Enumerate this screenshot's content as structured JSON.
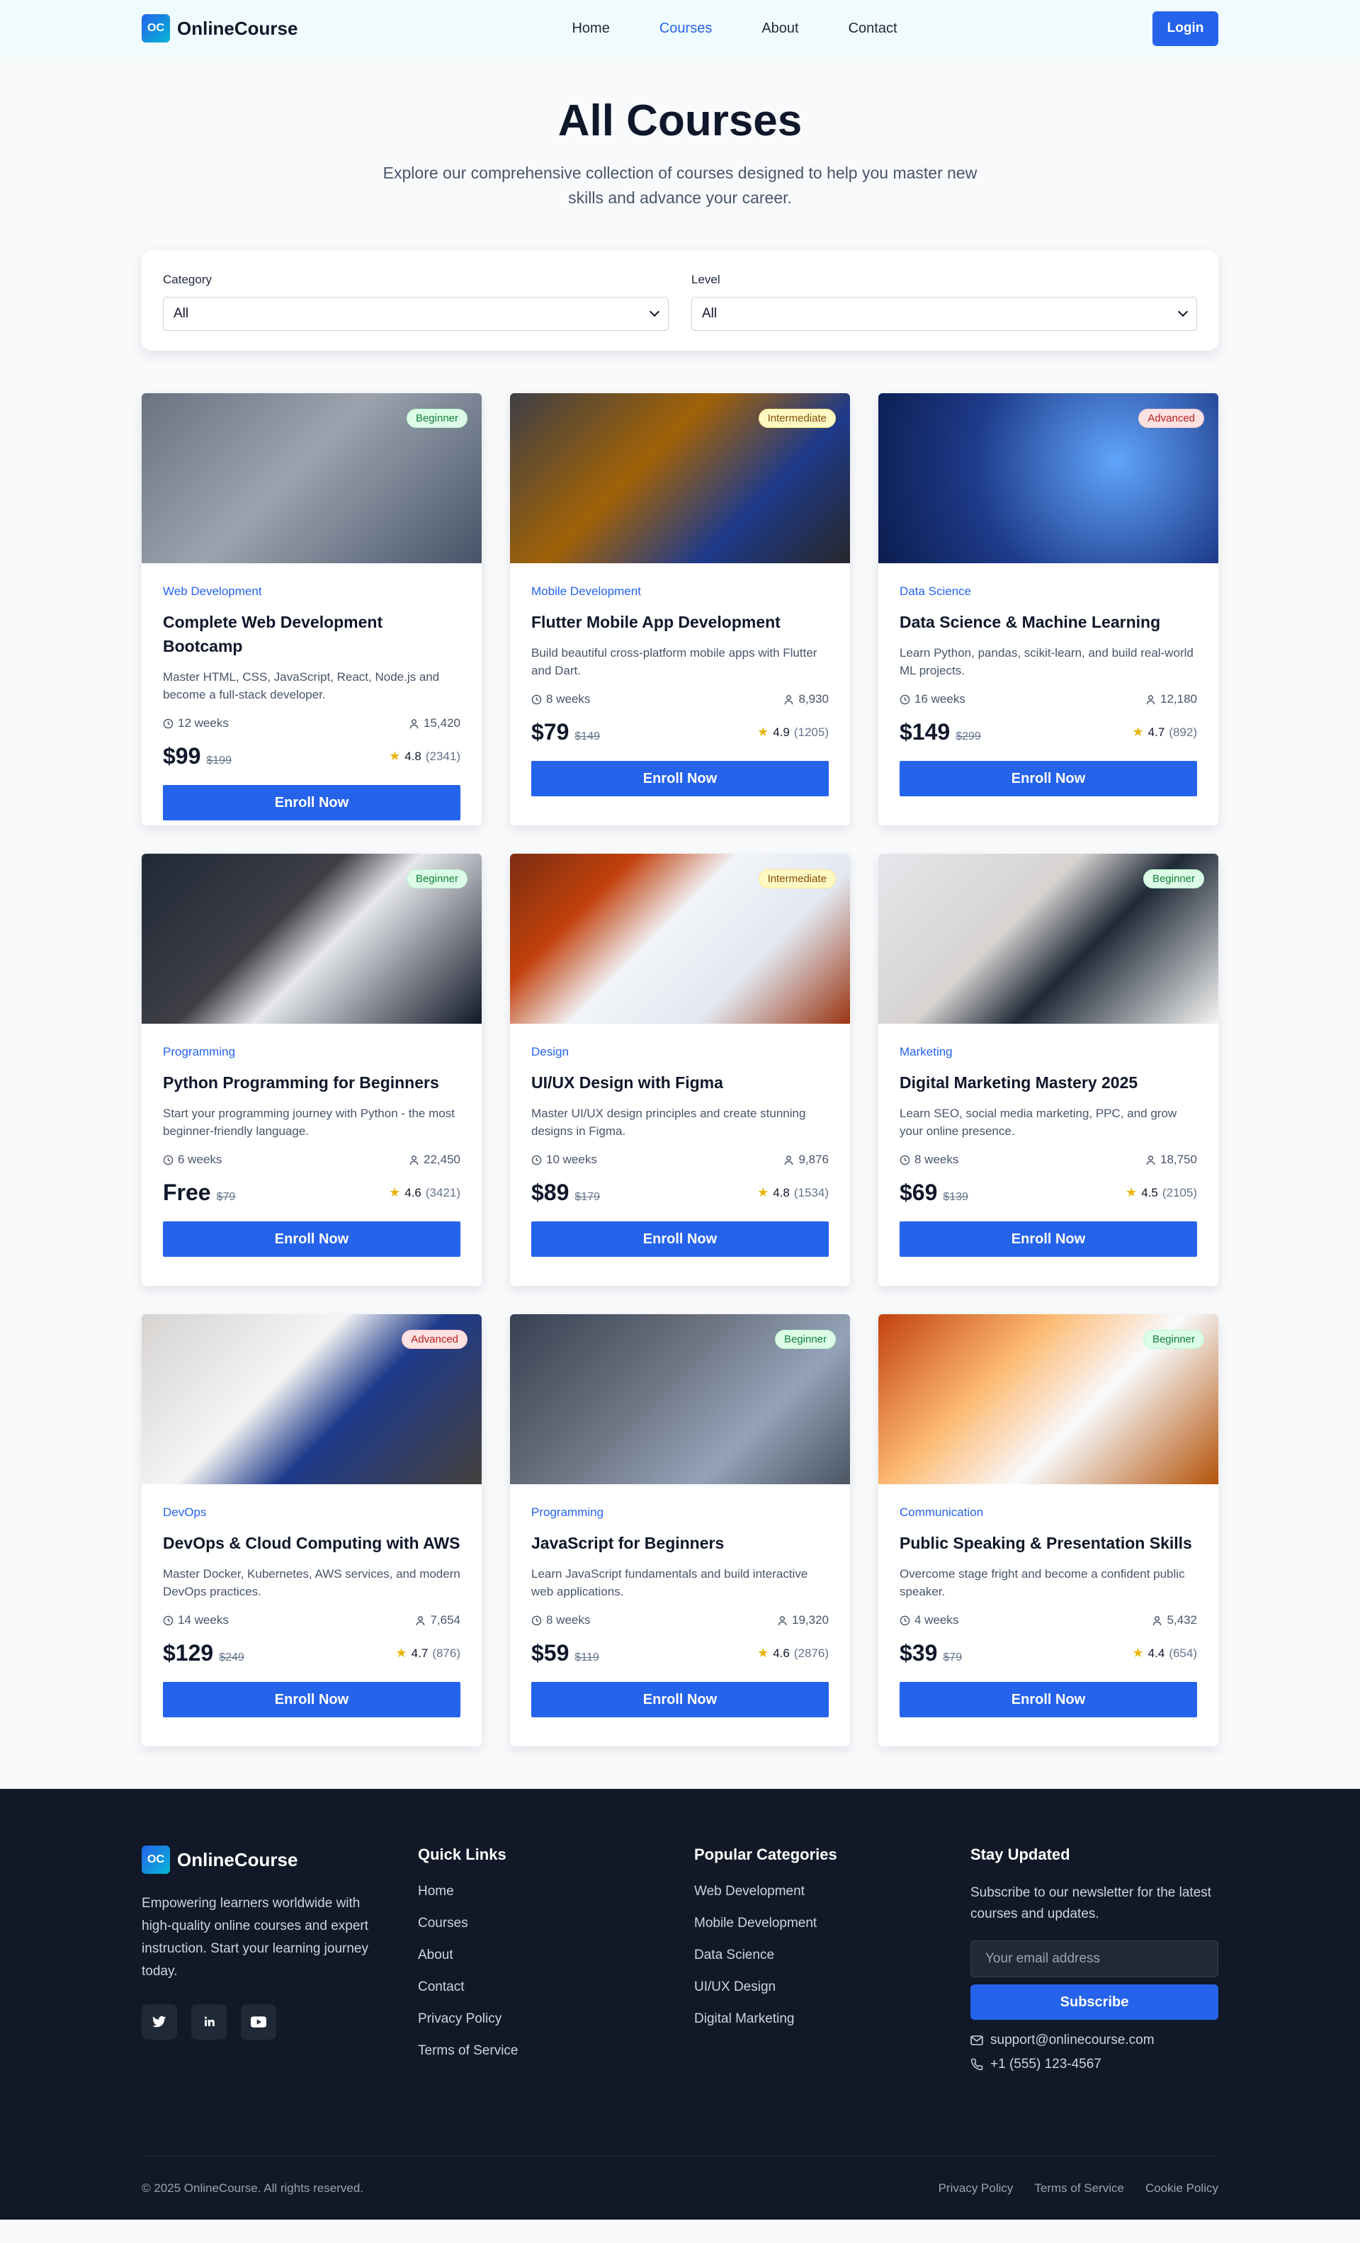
{
  "brand": {
    "logo_badge": "OC",
    "name": "OnlineCourse"
  },
  "nav": {
    "items": [
      {
        "label": "Home",
        "active": false
      },
      {
        "label": "Courses",
        "active": true
      },
      {
        "label": "About",
        "active": false
      },
      {
        "label": "Contact",
        "active": false
      }
    ],
    "login_label": "Login"
  },
  "hero": {
    "title": "All Courses",
    "subtitle": "Explore our comprehensive collection of courses designed to help you master new skills and advance your career."
  },
  "filters": {
    "category": {
      "label": "Category",
      "value": "All"
    },
    "level": {
      "label": "Level",
      "value": "All"
    }
  },
  "courses": [
    {
      "level": "Beginner",
      "category": "Web Development",
      "title": "Complete Web Development Bootcamp",
      "description": "Master HTML, CSS, JavaScript, React, Node.js and become a full-stack developer.",
      "duration": "12 weeks",
      "students": "15,420",
      "price": "$99",
      "old_price": "$199",
      "rating": "4.8",
      "reviews": "(2341)",
      "cta": "Enroll Now"
    },
    {
      "level": "Intermediate",
      "category": "Mobile Development",
      "title": "Flutter Mobile App Development",
      "description": "Build beautiful cross-platform mobile apps with Flutter and Dart.",
      "duration": "8 weeks",
      "students": "8,930",
      "price": "$79",
      "old_price": "$149",
      "rating": "4.9",
      "reviews": "(1205)",
      "cta": "Enroll Now"
    },
    {
      "level": "Advanced",
      "category": "Data Science",
      "title": "Data Science & Machine Learning",
      "description": "Learn Python, pandas, scikit-learn, and build real-world ML projects.",
      "duration": "16 weeks",
      "students": "12,180",
      "price": "$149",
      "old_price": "$299",
      "rating": "4.7",
      "reviews": "(892)",
      "cta": "Enroll Now"
    },
    {
      "level": "Beginner",
      "category": "Programming",
      "title": "Python Programming for Beginners",
      "description": "Start your programming journey with Python - the most beginner-friendly language.",
      "duration": "6 weeks",
      "students": "22,450",
      "price": "Free",
      "old_price": "$79",
      "rating": "4.6",
      "reviews": "(3421)",
      "cta": "Enroll Now"
    },
    {
      "level": "Intermediate",
      "category": "Design",
      "title": "UI/UX Design with Figma",
      "description": "Master UI/UX design principles and create stunning designs in Figma.",
      "duration": "10 weeks",
      "students": "9,876",
      "price": "$89",
      "old_price": "$179",
      "rating": "4.8",
      "reviews": "(1534)",
      "cta": "Enroll Now"
    },
    {
      "level": "Beginner",
      "category": "Marketing",
      "title": "Digital Marketing Mastery 2025",
      "description": "Learn SEO, social media marketing, PPC, and grow your online presence.",
      "duration": "8 weeks",
      "students": "18,750",
      "price": "$69",
      "old_price": "$139",
      "rating": "4.5",
      "reviews": "(2105)",
      "cta": "Enroll Now"
    },
    {
      "level": "Advanced",
      "category": "DevOps",
      "title": "DevOps & Cloud Computing with AWS",
      "description": "Master Docker, Kubernetes, AWS services, and modern DevOps practices.",
      "duration": "14 weeks",
      "students": "7,654",
      "price": "$129",
      "old_price": "$249",
      "rating": "4.7",
      "reviews": "(876)",
      "cta": "Enroll Now"
    },
    {
      "level": "Beginner",
      "category": "Programming",
      "title": "JavaScript for Beginners",
      "description": "Learn JavaScript fundamentals and build interactive web applications.",
      "duration": "8 weeks",
      "students": "19,320",
      "price": "$59",
      "old_price": "$119",
      "rating": "4.6",
      "reviews": "(2876)",
      "cta": "Enroll Now"
    },
    {
      "level": "Beginner",
      "category": "Communication",
      "title": "Public Speaking & Presentation Skills",
      "description": "Overcome stage fright and become a confident public speaker.",
      "duration": "4 weeks",
      "students": "5,432",
      "price": "$39",
      "old_price": "$79",
      "rating": "4.4",
      "reviews": "(654)",
      "cta": "Enroll Now"
    }
  ],
  "footer": {
    "about": "Empowering learners worldwide with high-quality online courses and expert instruction. Start your learning journey today.",
    "quick_links": {
      "heading": "Quick Links",
      "items": [
        "Home",
        "Courses",
        "About",
        "Contact",
        "Privacy Policy",
        "Terms of Service"
      ]
    },
    "categories": {
      "heading": "Popular Categories",
      "items": [
        "Web Development",
        "Mobile Development",
        "Data Science",
        "UI/UX Design",
        "Digital Marketing"
      ]
    },
    "newsletter": {
      "heading": "Stay Updated",
      "text": "Subscribe to our newsletter for the latest courses and updates.",
      "placeholder": "Your email address",
      "button": "Subscribe",
      "email": "support@onlinecourse.com",
      "phone": "+1 (555) 123-4567"
    },
    "copyright": "© 2025 OnlineCourse. All rights reserved.",
    "bottom_links": [
      "Privacy Policy",
      "Terms of Service",
      "Cookie Policy"
    ]
  },
  "colors": {
    "accent": "#2563eb",
    "footer_bg": "#111827",
    "star": "#eab308"
  }
}
